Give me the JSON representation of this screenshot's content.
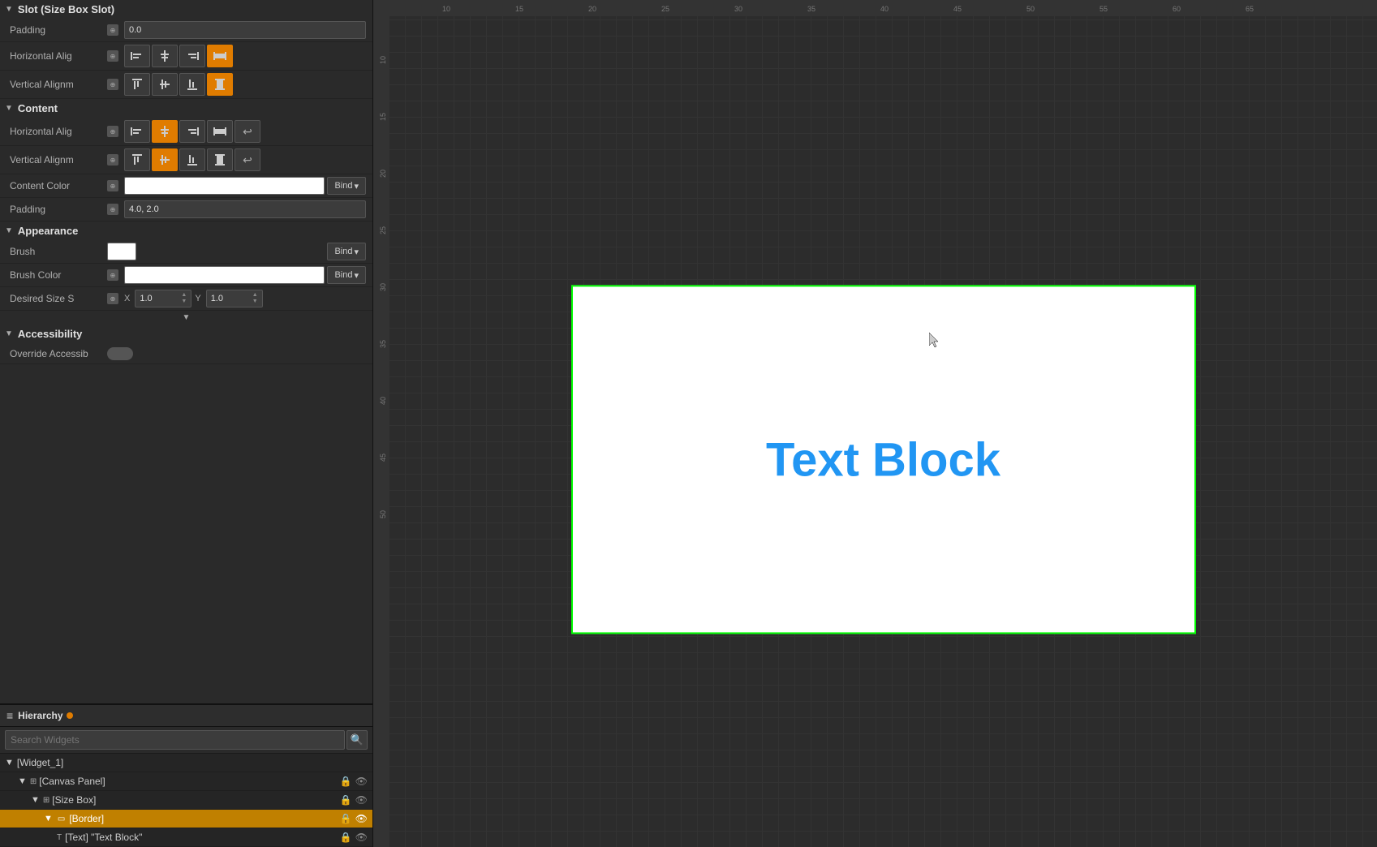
{
  "leftPanel": {
    "slotSection": {
      "title": "Slot (Size Box Slot)",
      "paddingLabel": "Padding",
      "paddingValue": "0.0",
      "horizontalAlignLabel": "Horizontal Alig",
      "verticalAlignLabel": "Vertical Alignm",
      "horizontalAlignButtons": [
        {
          "icon": "align-left",
          "active": false
        },
        {
          "icon": "align-center",
          "active": false
        },
        {
          "icon": "align-right",
          "active": false
        },
        {
          "icon": "align-fill",
          "active": true
        }
      ],
      "verticalAlignButtons": [
        {
          "icon": "align-top",
          "active": false
        },
        {
          "icon": "align-vcenter",
          "active": false
        },
        {
          "icon": "align-bottom",
          "active": false
        },
        {
          "icon": "align-vfill",
          "active": true
        }
      ]
    },
    "contentSection": {
      "title": "Content",
      "horizontalAlignLabel": "Horizontal Alig",
      "verticalAlignLabel": "Vertical Alignm",
      "horizontalAlignButtons": [
        {
          "icon": "align-left",
          "active": false
        },
        {
          "icon": "align-center",
          "active": true
        },
        {
          "icon": "align-right",
          "active": false
        },
        {
          "icon": "align-fill",
          "active": false
        }
      ],
      "verticalAlignButtons": [
        {
          "icon": "align-top",
          "active": false
        },
        {
          "icon": "align-vcenter",
          "active": true
        },
        {
          "icon": "align-bottom",
          "active": false
        },
        {
          "icon": "align-vfill",
          "active": false
        }
      ],
      "contentColorLabel": "Content Color",
      "bindLabel": "Bind",
      "paddingLabel": "Padding",
      "paddingValue": "4.0, 2.0"
    },
    "appearanceSection": {
      "title": "Appearance",
      "brushLabel": "Brush",
      "brushColorLabel": "Brush Color",
      "desiredSizeLabel": "Desired Size S",
      "bindLabel": "Bind",
      "xLabel": "X",
      "xValue": "1.0",
      "yLabel": "Y",
      "yValue": "1.0"
    },
    "accessibilitySection": {
      "title": "Accessibility",
      "overrideLabel": "Override Accessib"
    }
  },
  "hierarchy": {
    "title": "Hierarchy",
    "searchPlaceholder": "Search Widgets",
    "items": [
      {
        "label": "[Widget_1]",
        "indent": 0,
        "expanded": true,
        "type": "root",
        "showIcons": false
      },
      {
        "label": "[Canvas Panel]",
        "indent": 1,
        "expanded": true,
        "type": "canvas",
        "showIcons": true
      },
      {
        "label": "[Size Box]",
        "indent": 2,
        "expanded": true,
        "type": "sizebox",
        "showIcons": true
      },
      {
        "label": "[Border]",
        "indent": 3,
        "expanded": true,
        "type": "border",
        "showIcons": true,
        "selected": true
      },
      {
        "label": "[Text] \"Text Block\"",
        "indent": 4,
        "expanded": false,
        "type": "text",
        "showIcons": true
      }
    ]
  },
  "canvas": {
    "textBlockContent": "Text Block",
    "textColor": "#2196F3"
  },
  "rulerNumbers": {
    "top": [
      "10",
      "15",
      "20",
      "25",
      "30",
      "35",
      "40"
    ],
    "left": [
      "10",
      "15",
      "20",
      "25",
      "30",
      "35",
      "40",
      "45",
      "50"
    ]
  }
}
